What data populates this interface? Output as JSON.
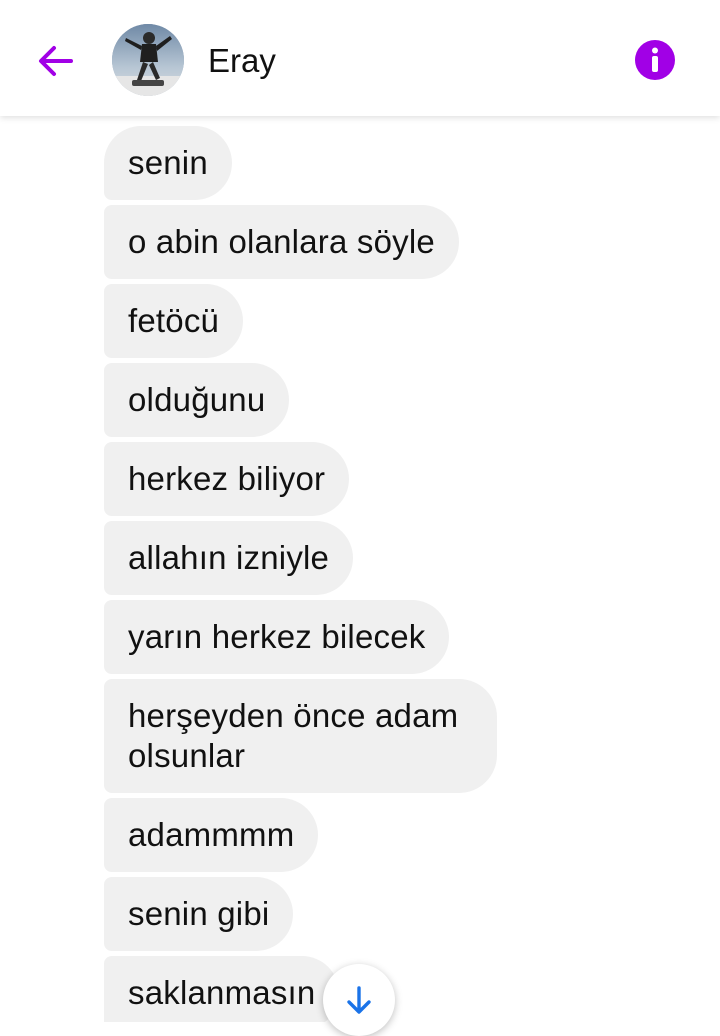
{
  "header": {
    "contact_name": "Eray",
    "back_icon": "arrow-left-icon",
    "info_icon": "info-icon",
    "accent_color": "#a100e6"
  },
  "messages": [
    {
      "text": "senin"
    },
    {
      "text": "o abin olanlara söyle"
    },
    {
      "text": "fetöcü"
    },
    {
      "text": "olduğunu"
    },
    {
      "text": "herkez biliyor"
    },
    {
      "text": "allahın izniyle"
    },
    {
      "text": "yarın herkez bilecek"
    },
    {
      "text": "herşeyden önce adam olsunlar"
    },
    {
      "text": "adammmm"
    },
    {
      "text": "senin gibi"
    },
    {
      "text": "saklanmasın"
    }
  ],
  "scroll_button": {
    "icon": "arrow-down-icon",
    "color": "#1a73e8"
  }
}
